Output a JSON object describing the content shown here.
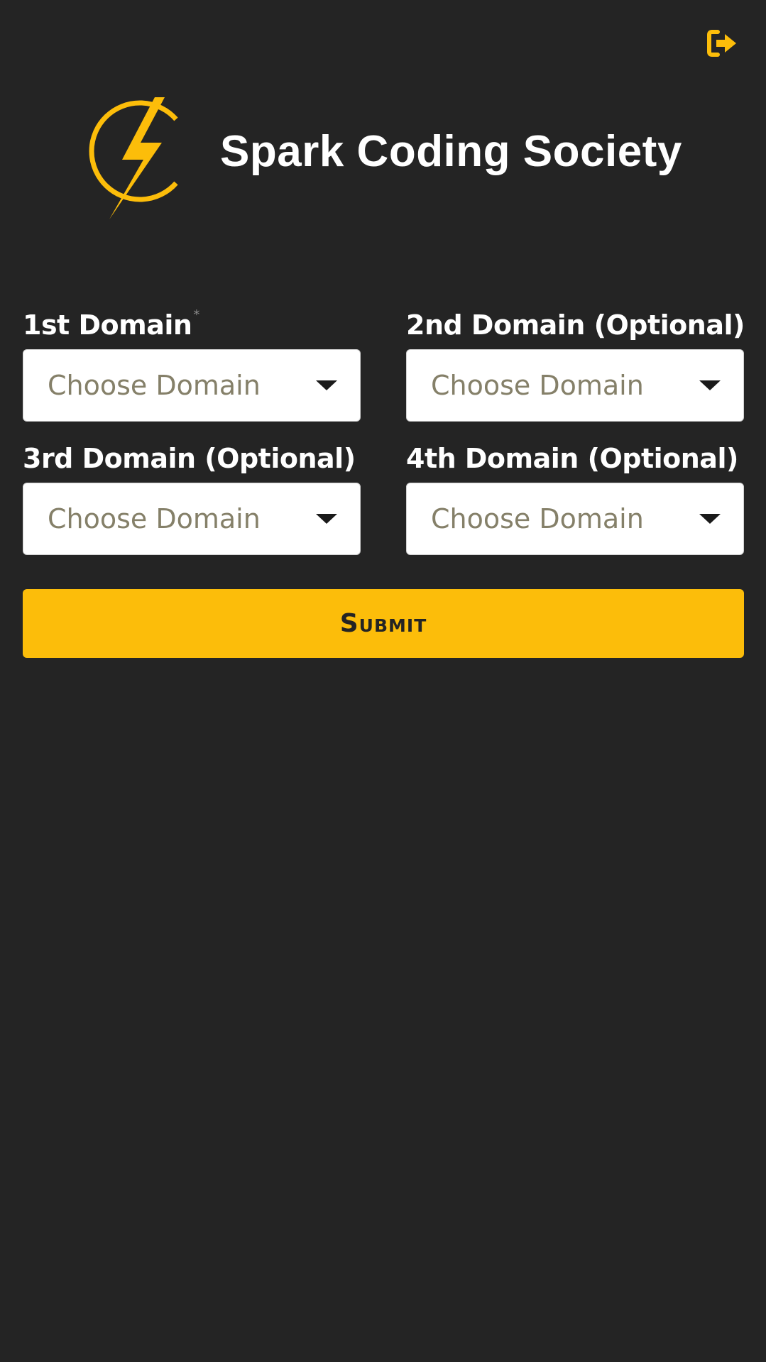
{
  "header": {
    "title": "Spark Coding Society",
    "logout_icon": "logout-icon",
    "logo_icon": "lightning-bolt-logo"
  },
  "form": {
    "fields": [
      {
        "label": "1st Domain",
        "required_mark": "*",
        "placeholder": "Choose Domain"
      },
      {
        "label": "2nd Domain (Optional)",
        "required_mark": "",
        "placeholder": "Choose Domain"
      },
      {
        "label": "3rd Domain (Optional)",
        "required_mark": "",
        "placeholder": "Choose Domain"
      },
      {
        "label": "4th Domain (Optional)",
        "required_mark": "",
        "placeholder": "Choose Domain"
      }
    ],
    "submit_label": "Submit"
  },
  "colors": {
    "background": "#242424",
    "accent": "#fcbd0a",
    "text": "#ffffff",
    "placeholder": "#858069"
  }
}
